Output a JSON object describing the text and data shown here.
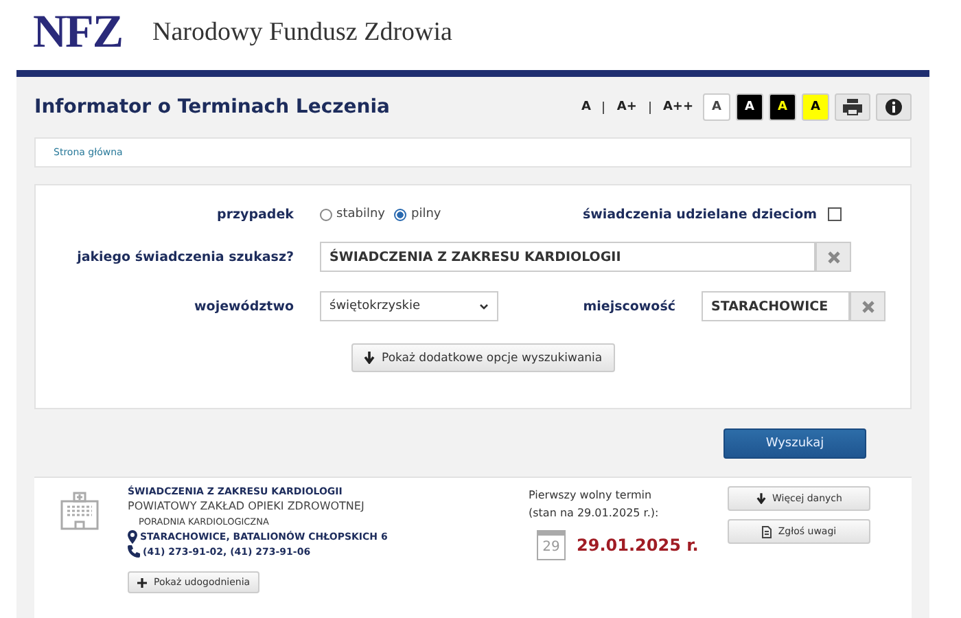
{
  "header": {
    "logo": "NFZ",
    "org_name": "Narodowy Fundusz Zdrowia"
  },
  "page_title": "Informator o Terminach Leczenia",
  "font_sizes": [
    {
      "label": "A"
    },
    {
      "label": "A+"
    },
    {
      "label": "A++"
    }
  ],
  "contrast_buttons": [
    {
      "label": "A",
      "kind": "white"
    },
    {
      "label": "A",
      "kind": "black"
    },
    {
      "label": "A",
      "kind": "black-yellow"
    },
    {
      "label": "A",
      "kind": "yellow"
    }
  ],
  "breadcrumb": "Strona główna",
  "form": {
    "case_label": "przypadek",
    "case_options": [
      {
        "label": "stabilny",
        "selected": false
      },
      {
        "label": "pilny",
        "selected": true
      }
    ],
    "children_label": "świadczenia udzielane dzieciom",
    "children_checked": false,
    "service_label": "jakiego świadczenia szukasz?",
    "service_value": "ŚWIADCZENIA Z ZAKRESU KARDIOLOGII",
    "province_label": "województwo",
    "province_value": "świętokrzyskie",
    "city_label": "miejscowość",
    "city_value": "STARACHOWICE",
    "more_options": "Pokaż dodatkowe opcje wyszukiwania",
    "search_button": "Wyszukaj"
  },
  "result": {
    "service": "ŚWIADCZENIA Z ZAKRESU KARDIOLOGII",
    "provider": "POWIATOWY ZAKŁAD OPIEKI ZDROWOTNEJ",
    "unit": "PORADNIA KARDIOLOGICZNA",
    "address": "STARACHOWICE, BATALIONÓW CHŁOPSKICH 6",
    "phone": "(41) 273-91-02, (41) 273-91-06",
    "amenities_button": "Pokaż udogodnienia",
    "first_date_label": "Pierwszy wolny termin",
    "state_label": "(stan na 29.01.2025 r.):",
    "calendar_day": "29",
    "date": "29.01.2025 r.",
    "more_button": "Więcej danych",
    "report_button": "Zgłoś uwagi"
  }
}
